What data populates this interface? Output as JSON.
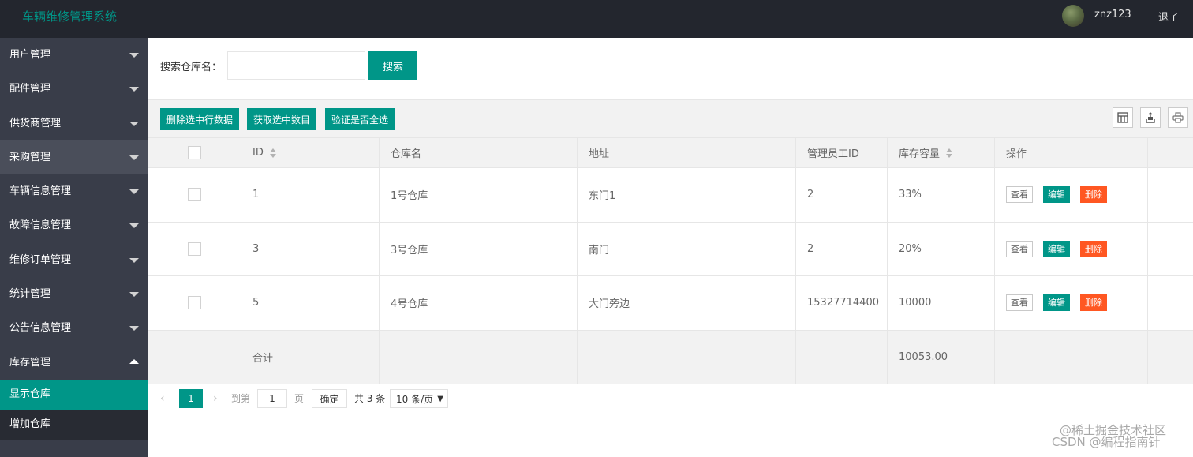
{
  "header": {
    "title": "车辆维修管理系统",
    "username": "znz123",
    "logout": "退了"
  },
  "sidebar": {
    "items": [
      "用户管理",
      "配件管理",
      "供货商管理",
      "采购管理",
      "车辆信息管理",
      "故障信息管理",
      "维修订单管理",
      "统计管理",
      "公告信息管理",
      "库存管理"
    ],
    "subitems": [
      "显示仓库",
      "增加仓库"
    ]
  },
  "search": {
    "label": "搜索仓库名：",
    "value": "",
    "button": "搜索"
  },
  "toolbar": {
    "delete_selected": "删除选中行数据",
    "get_count": "获取选中数目",
    "check_all": "验证是否全选"
  },
  "table": {
    "headers": [
      "ID",
      "仓库名",
      "地址",
      "管理员工ID",
      "库存容量",
      "操作"
    ],
    "rows": [
      {
        "id": "1",
        "name": "1号仓库",
        "address": "东门1",
        "manager_id": "2",
        "capacity": "33%"
      },
      {
        "id": "3",
        "name": "3号仓库",
        "address": "南门",
        "manager_id": "2",
        "capacity": "20%"
      },
      {
        "id": "5",
        "name": "4号仓库",
        "address": "大门旁边",
        "manager_id": "15327714400",
        "capacity": "10000"
      }
    ],
    "actions": {
      "view": "查看",
      "edit": "编辑",
      "delete": "删除"
    },
    "total_label": "合计",
    "total_value": "10053.00"
  },
  "pager": {
    "current": "1",
    "goto_label": "到第",
    "page_input": "1",
    "page_unit": "页",
    "confirm": "确定",
    "total": "共 3 条",
    "page_size": "10 条/页"
  },
  "watermark": {
    "line1": "@稀土掘金技术社区",
    "line2": "CSDN @编程指南针"
  }
}
